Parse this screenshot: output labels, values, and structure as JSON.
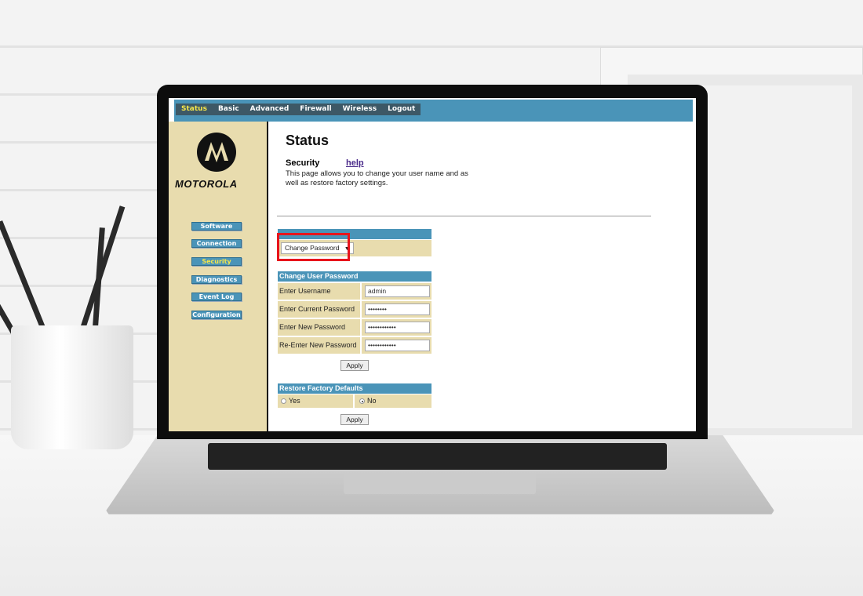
{
  "nav": {
    "tabs": [
      "Status",
      "Basic",
      "Advanced",
      "Firewall",
      "Wireless",
      "Logout"
    ],
    "active": "Status"
  },
  "brand": {
    "logo_text": "MOTOROLA"
  },
  "sidebar": {
    "items": [
      "Software",
      "Connection",
      "Security",
      "Diagnostics",
      "Event Log",
      "Configuration"
    ],
    "active": "Security"
  },
  "main": {
    "title": "Status",
    "section": "Security",
    "help": "help",
    "description": "This page allows you to change your user name and as well as restore factory settings."
  },
  "selector": {
    "value": "Change Password",
    "arrow": "▼"
  },
  "password_form": {
    "title": "Change User Password",
    "fields": [
      {
        "label": "Enter Username",
        "value": "admin"
      },
      {
        "label": "Enter Current Password",
        "value": "••••••••"
      },
      {
        "label": "Enter New Password",
        "value": "••••••••••••"
      },
      {
        "label": "Re-Enter New Password",
        "value": "••••••••••••"
      }
    ],
    "apply": "Apply"
  },
  "restore_form": {
    "title": "Restore Factory Defaults",
    "options": [
      "Yes",
      "No"
    ],
    "selected": "No",
    "apply": "Apply"
  },
  "colors": {
    "accent": "#4a94b8",
    "sidebar": "#e8dcae",
    "active_text": "#f5e64a",
    "highlight": "#e8141b"
  }
}
